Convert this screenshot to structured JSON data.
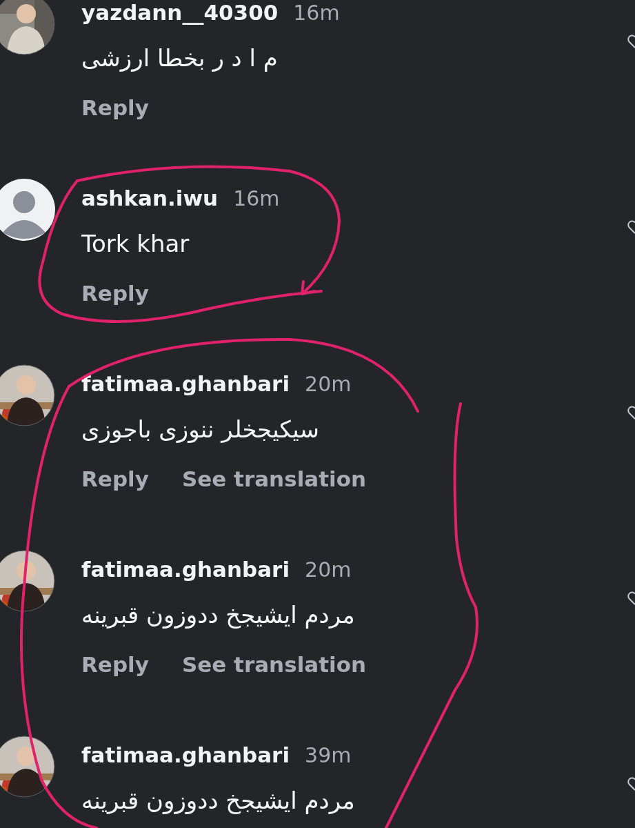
{
  "comments": [
    {
      "avatar": {
        "kind": "picture"
      },
      "username": "yazdann__40300",
      "time": "16m",
      "text": "م ا د ر بخطا ارزشی",
      "actions": [
        "Reply"
      ]
    },
    {
      "avatar": {
        "kind": "default"
      },
      "username": "ashkan.iwu",
      "time": "16m",
      "text": "Tork khar",
      "actions": [
        "Reply"
      ]
    },
    {
      "avatar": {
        "kind": "picture"
      },
      "username": "fatimaa.ghanbari",
      "time": "20m",
      "text": "سیکیجخلر ننوزی باجوزی",
      "actions": [
        "Reply",
        "See translation"
      ]
    },
    {
      "avatar": {
        "kind": "picture"
      },
      "username": "fatimaa.ghanbari",
      "time": "20m",
      "text": "مردم ایشیجخ ددوزون قبرینه",
      "actions": [
        "Reply",
        "See translation"
      ]
    },
    {
      "avatar": {
        "kind": "picture"
      },
      "username": "fatimaa.ghanbari",
      "time": "39m",
      "text": "مردم ایشیجخ ددوزون قبرینه"
    }
  ],
  "annotations": [
    {
      "arrow": true
    },
    {
      "arrow": false
    }
  ]
}
